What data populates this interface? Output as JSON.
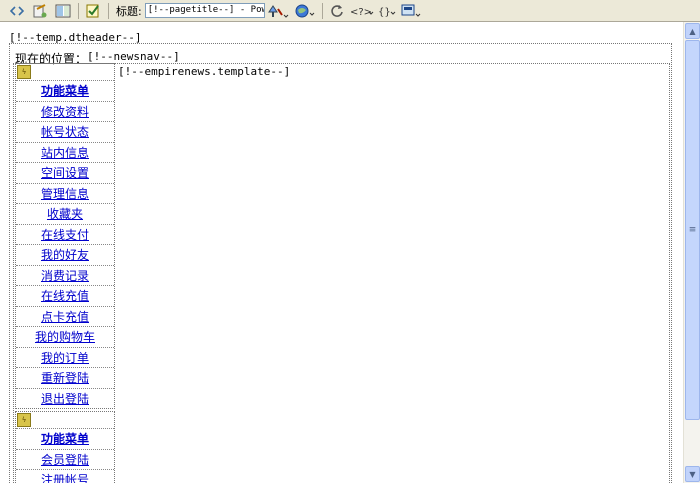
{
  "toolbar": {
    "title_label": "标题:",
    "title_value": "[!--pagetitle--] - Powere",
    "icons": [
      "code-view",
      "design-view",
      "split-view",
      "check-page",
      "file-manage",
      "preview",
      "refresh",
      "code-nav",
      "tag-insert",
      "visual-aids"
    ]
  },
  "page": {
    "dtheader": "[!--temp.dtheader--]",
    "location_prefix": "现在的位置：",
    "newsnav": "[!--newsnav--]",
    "template": "[!--empirenews.template--]"
  },
  "menu": {
    "group1": [
      {
        "label": "功能菜单",
        "header": true
      },
      {
        "label": "修改资料"
      },
      {
        "label": "帐号状态"
      },
      {
        "label": "站内信息"
      },
      {
        "label": "空间设置"
      },
      {
        "label": "管理信息"
      },
      {
        "label": "收藏夹"
      },
      {
        "label": "在线支付"
      },
      {
        "label": "我的好友"
      },
      {
        "label": "消费记录"
      },
      {
        "label": "在线充值"
      },
      {
        "label": "点卡充值"
      },
      {
        "label": "我的购物车"
      },
      {
        "label": "我的订单"
      },
      {
        "label": "重新登陆"
      },
      {
        "label": "退出登陆"
      }
    ],
    "group2": [
      {
        "label": "功能菜单",
        "header": true
      },
      {
        "label": "会员登陆"
      },
      {
        "label": "注册帐号"
      }
    ]
  },
  "colors": {
    "link": "#0000cc",
    "toolbar_bg": "#ece9d8",
    "scroll": "#c4d6fc"
  }
}
